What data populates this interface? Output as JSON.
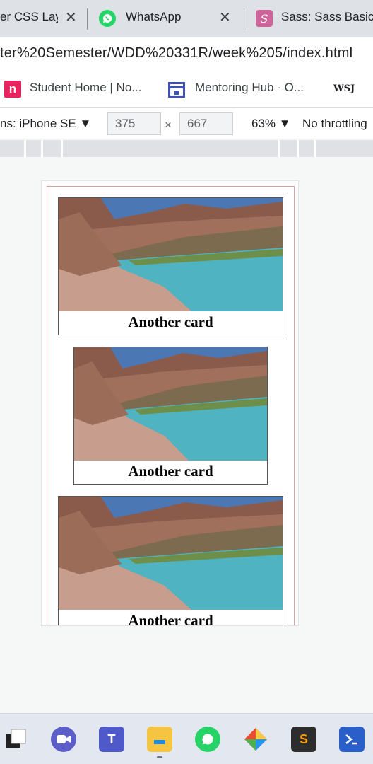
{
  "browser": {
    "tabs": [
      {
        "title": "er CSS Layout",
        "icon": "page-icon"
      },
      {
        "title": "WhatsApp",
        "icon": "whatsapp-icon"
      },
      {
        "title": "Sass: Sass Basics",
        "icon": "sass-icon"
      }
    ],
    "close_glyph": "✕",
    "url": "ter%20Semester/WDD%20331R/week%205/index.html",
    "bookmarks": [
      {
        "label": "Student Home | No...",
        "icon": "n-icon"
      },
      {
        "label": "Mentoring Hub - O...",
        "icon": "hub-icon"
      },
      {
        "label": "WSJ",
        "icon": "wsj-icon"
      }
    ]
  },
  "devtools": {
    "device_label": "ns: iPhone SE ▼",
    "width": "375",
    "times": "×",
    "height": "667",
    "zoom": "63% ▼",
    "throttling": "No throttling"
  },
  "page": {
    "cards": [
      {
        "title": "Another card"
      },
      {
        "title": "Another card"
      },
      {
        "title": "Another card"
      }
    ]
  },
  "taskbar": {
    "apps": [
      "square-icon",
      "zoom-icon",
      "teams-icon",
      "file-explorer-icon",
      "whatsapp-icon",
      "git-icon",
      "sublime-icon",
      "powershell-icon"
    ]
  },
  "colors": {
    "tab_bg": "#dee1e6",
    "container_border": "#d9a0a0",
    "whatsapp": "#25d366",
    "sass": "#cf649a"
  }
}
